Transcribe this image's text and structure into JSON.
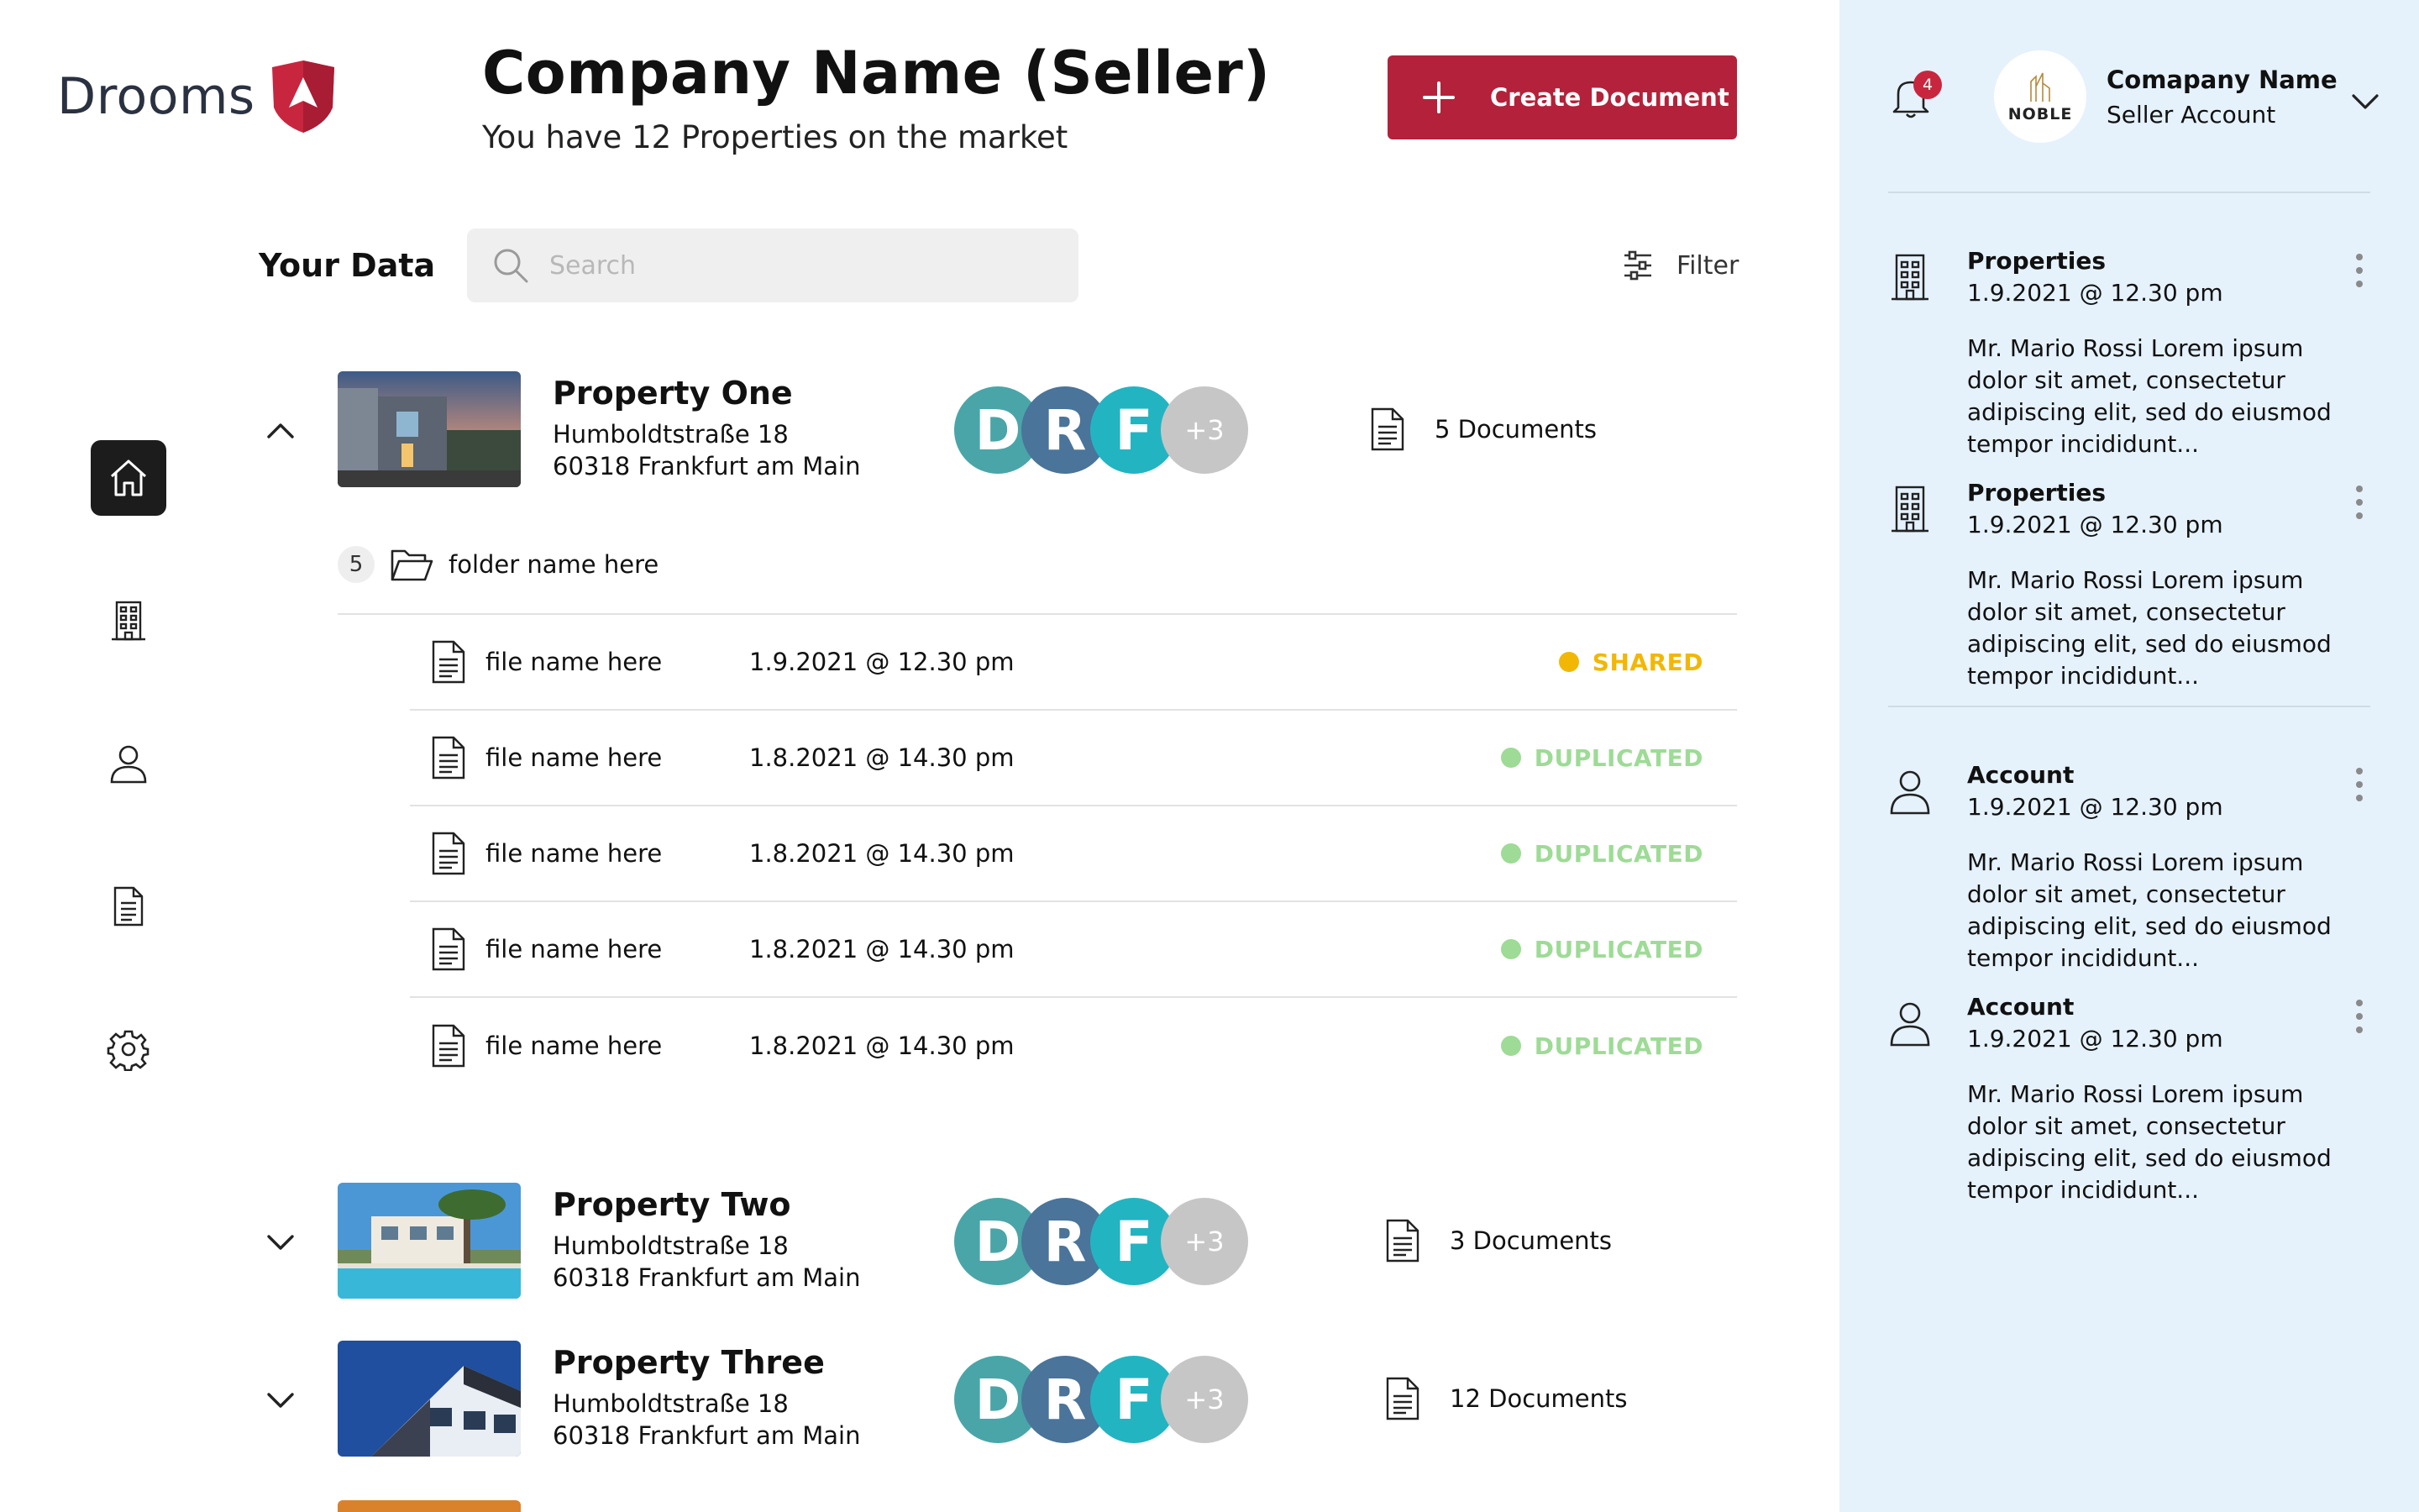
{
  "brand": {
    "name": "Drooms",
    "accent": "#c8263f"
  },
  "header": {
    "title": "Company Name (Seller)",
    "subtitle": "You have 12 Properties on the market",
    "create_label": "Create Document",
    "create_color": "#b3223a"
  },
  "nav": [
    {
      "icon": "home-icon",
      "active": true
    },
    {
      "icon": "building-icon",
      "active": false
    },
    {
      "icon": "user-icon",
      "active": false
    },
    {
      "icon": "document-icon",
      "active": false
    },
    {
      "icon": "gear-icon",
      "active": false
    }
  ],
  "toolbar": {
    "section_title": "Your Data",
    "search_placeholder": "Search",
    "filter_label": "Filter"
  },
  "properties": [
    {
      "name": "Property One",
      "street": "Humboldtstraße 18",
      "city": "60318 Frankfurt am Main",
      "avatars": [
        "D",
        "R",
        "F"
      ],
      "more": "+3",
      "documents": "5 Documents",
      "expanded": true
    },
    {
      "name": "Property Two",
      "street": "Humboldtstraße 18",
      "city": "60318 Frankfurt am Main",
      "avatars": [
        "D",
        "R",
        "F"
      ],
      "more": "+3",
      "documents": "3 Documents",
      "expanded": false
    },
    {
      "name": "Property Three",
      "street": "Humboldtstraße 18",
      "city": "60318 Frankfurt am Main",
      "avatars": [
        "D",
        "R",
        "F"
      ],
      "more": "+3",
      "documents": "12 Documents",
      "expanded": false
    }
  ],
  "avatar_colors": [
    "#4aa5a8",
    "#4a7499",
    "#23b4c2",
    "#c6c6c6"
  ],
  "folder": {
    "count": "5",
    "name": "folder name here"
  },
  "files": [
    {
      "name": "file name here",
      "date": "1.9.2021 @ 12.30 pm",
      "status": "SHARED",
      "color": "#f2b705"
    },
    {
      "name": "file name here",
      "date": "1.8.2021 @ 14.30 pm",
      "status": "DUPLICATED",
      "color": "#9edb96"
    },
    {
      "name": "file name here",
      "date": "1.8.2021 @ 14.30 pm",
      "status": "DUPLICATED",
      "color": "#9edb96"
    },
    {
      "name": "file name here",
      "date": "1.8.2021 @ 14.30 pm",
      "status": "DUPLICATED",
      "color": "#9edb96"
    },
    {
      "name": "file name here",
      "date": "1.8.2021 @ 14.30 pm",
      "status": "DUPLICATED",
      "color": "#9edb96"
    }
  ],
  "panel": {
    "notifications_count": "4",
    "account_logo_text": "NOBLE",
    "account_name": "Comapany Name",
    "account_type": "Seller Account",
    "background": "#e5f2fc",
    "notes": [
      {
        "icon": "building-icon",
        "title": "Properties",
        "date": "1.9.2021 @ 12.30 pm",
        "body": "Mr. Mario Rossi Lorem ipsum dolor sit amet, consectetur adipiscing elit, sed do eiusmod tempor incididunt..."
      },
      {
        "icon": "building-icon",
        "title": "Properties",
        "date": "1.9.2021 @ 12.30 pm",
        "body": "Mr. Mario Rossi Lorem ipsum dolor sit amet, consectetur adipiscing elit, sed do eiusmod tempor incididunt..."
      },
      {
        "icon": "user-icon",
        "title": "Account",
        "date": "1.9.2021 @ 12.30 pm",
        "body": "Mr. Mario Rossi Lorem ipsum dolor sit amet, consectetur adipiscing elit, sed do eiusmod tempor incididunt..."
      },
      {
        "icon": "user-icon",
        "title": "Account",
        "date": "1.9.2021 @ 12.30 pm",
        "body": "Mr. Mario Rossi Lorem ipsum dolor sit amet, consectetur adipiscing elit, sed do eiusmod tempor incididunt..."
      }
    ]
  }
}
